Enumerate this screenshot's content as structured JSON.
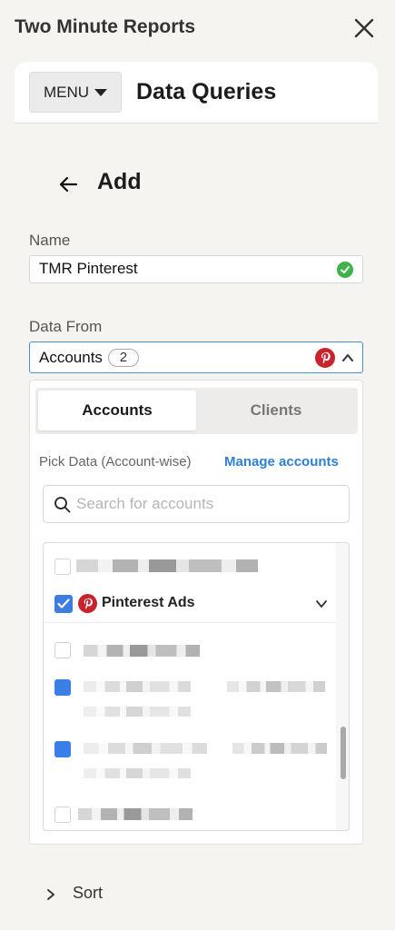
{
  "app": {
    "title": "Two Minute Reports"
  },
  "header": {
    "menu_label": "MENU",
    "title": "Data Queries"
  },
  "subheader": {
    "title": "Add"
  },
  "name_field": {
    "label": "Name",
    "value": "TMR Pinterest",
    "status": "valid"
  },
  "data_from": {
    "label": "Data From",
    "value": "Accounts",
    "count": "2",
    "source_icon": "pinterest-icon"
  },
  "tabs": [
    {
      "label": "Accounts",
      "active": true
    },
    {
      "label": "Clients",
      "active": false
    }
  ],
  "pick": {
    "label": "Pick Data (Account-wise)",
    "manage_label": "Manage accounts"
  },
  "search": {
    "placeholder": "Search for accounts"
  },
  "accounts_list": {
    "expanded_group": {
      "label": "Pinterest Ads",
      "checked": true
    }
  },
  "sort": {
    "label": "Sort"
  },
  "colors": {
    "accent": "#3e7de0",
    "link": "#2f7fd3",
    "pinterest": "#c8232c",
    "success": "#3db34a"
  }
}
